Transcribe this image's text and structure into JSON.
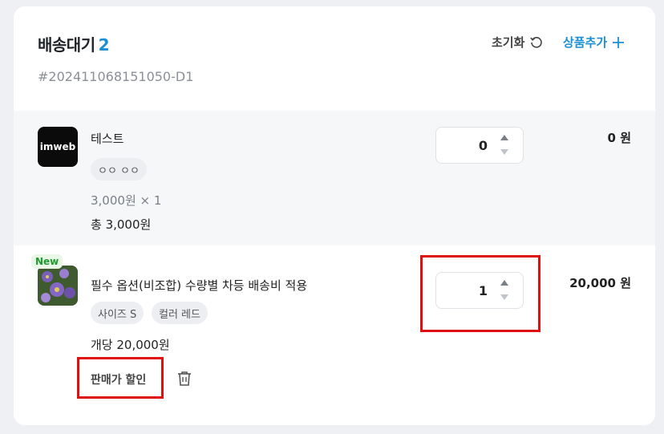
{
  "header": {
    "title": "배송대기",
    "count": "2",
    "order_no": "#202411068151050-D1",
    "reset_label": "초기화",
    "add_label": "상품추가"
  },
  "items": [
    {
      "thumb_text": "imweb",
      "name": "테스트",
      "options": [
        "ㅇㅇ ㅇㅇ"
      ],
      "unit_line": "3,000원 × 1",
      "total_line": "총 3,000원",
      "quantity": "0",
      "price": "0 원"
    },
    {
      "badge": "New",
      "name": "필수 옵션(비조합) 수량별 차등 배송비 적용",
      "options": [
        "사이즈 S",
        "컬러 레드"
      ],
      "unit_price_line": "개당 20,000원",
      "quantity": "1",
      "price": "20,000 원",
      "discount_label": "판매가 할인"
    }
  ],
  "colors": {
    "accent": "#1a8fd6",
    "highlight": "#e01010",
    "new_badge": "#1f9a2d"
  },
  "icons": [
    "refresh-icon",
    "plus-icon",
    "trash-icon",
    "caret-up-icon",
    "caret-down-icon"
  ]
}
